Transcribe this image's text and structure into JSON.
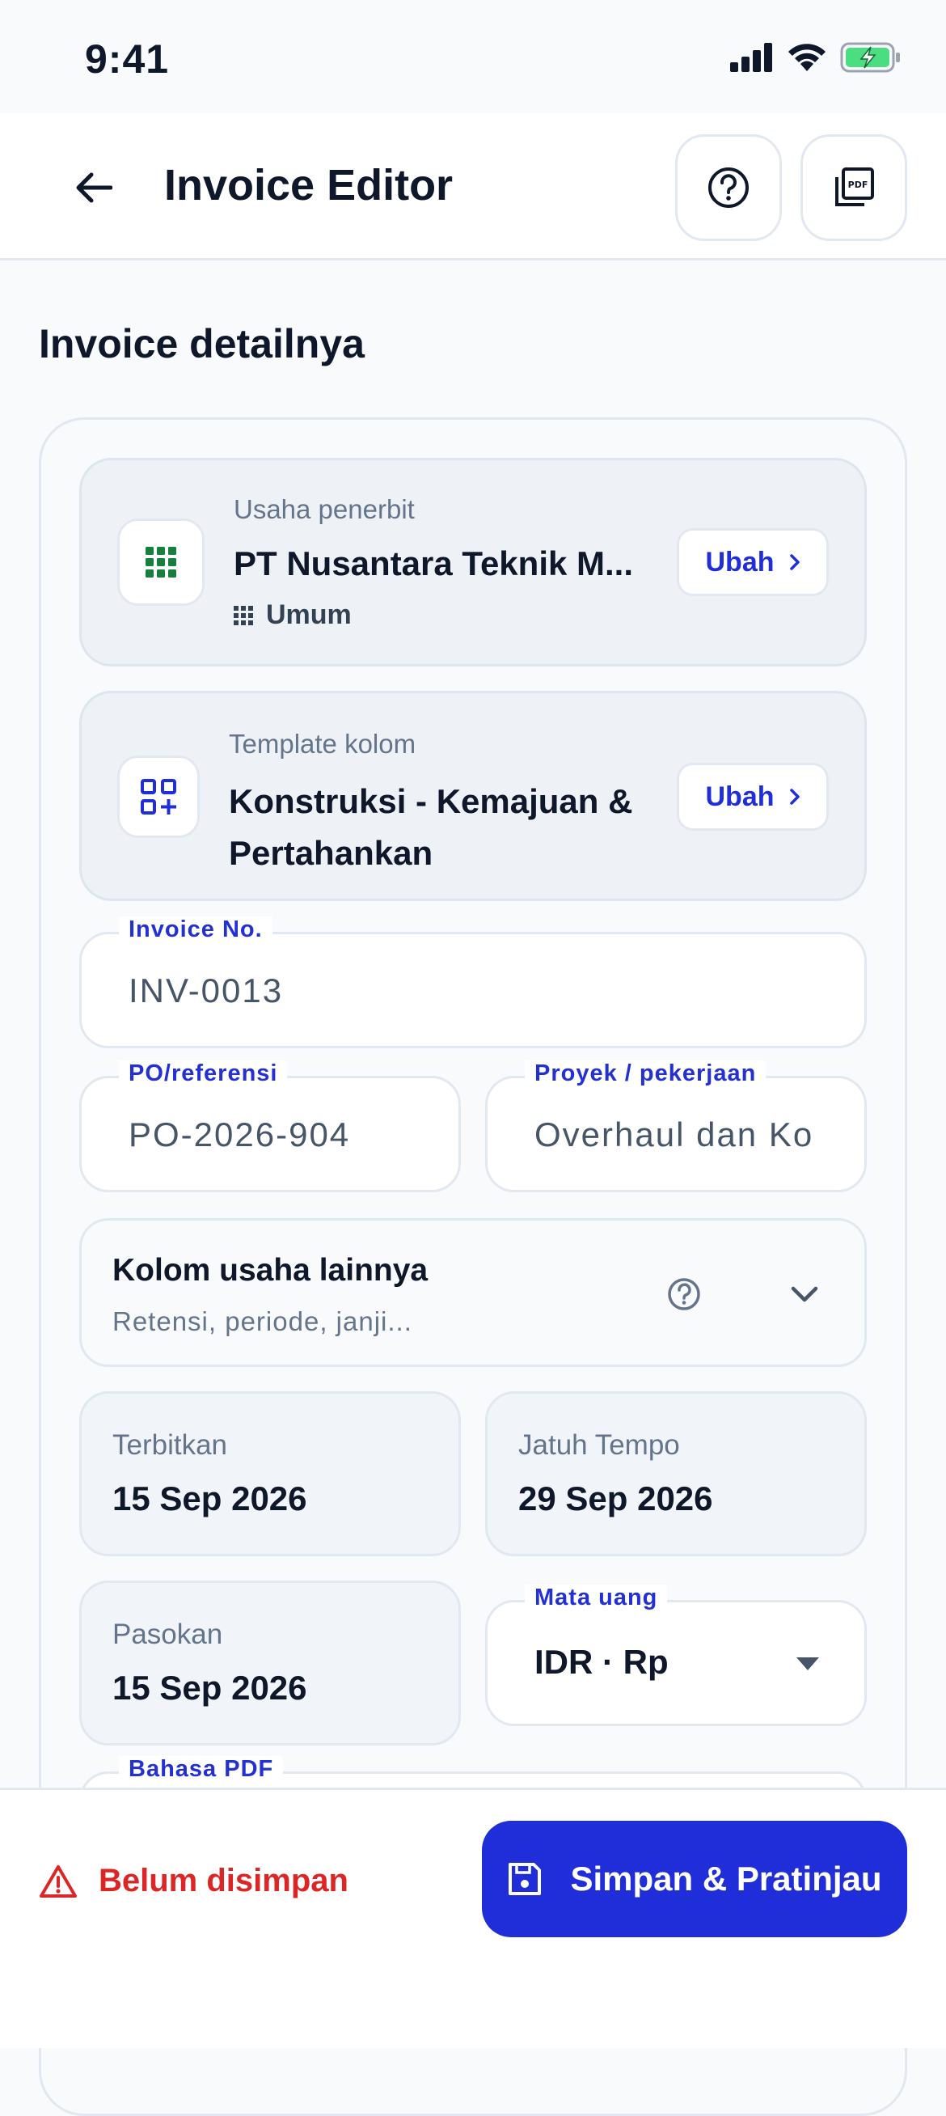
{
  "status_bar": {
    "time": "9:41"
  },
  "app_bar": {
    "title": "Invoice Editor"
  },
  "section": {
    "title": "Invoice detailnya"
  },
  "issuer_card": {
    "label": "Usaha penerbit",
    "value": "PT Nusantara Teknik M...",
    "tag": "Umum",
    "change_label": "Ubah"
  },
  "template_card": {
    "label": "Template kolom",
    "value_line1": "Konstruksi - Kemajuan &",
    "value_line2": "Pertahankan",
    "change_label": "Ubah"
  },
  "fields": {
    "invoice_no": {
      "label": "Invoice No.",
      "value": "INV-0013"
    },
    "po_ref": {
      "label": "PO/referensi",
      "value": "PO-2026-904"
    },
    "project": {
      "label": "Proyek / pekerjaan",
      "value": "Overhaul dan Ko"
    },
    "currency": {
      "label": "Mata uang",
      "value": "IDR · Rp"
    },
    "pdf_language": {
      "label": "Bahasa PDF"
    }
  },
  "more_fields": {
    "title": "Kolom usaha lainnya",
    "subtitle": "Retensi, periode, janji..."
  },
  "dates": {
    "issued": {
      "label": "Terbitkan",
      "value": "15 Sep 2026"
    },
    "due": {
      "label": "Jatuh Tempo",
      "value": "29 Sep 2026"
    },
    "supply": {
      "label": "Pasokan",
      "value": "15 Sep 2026"
    }
  },
  "bottom_bar": {
    "unsaved_label": "Belum disimpan",
    "save_label": "Simpan & Pratinjau"
  },
  "colors": {
    "accent": "#1f2ed8",
    "danger": "#dc2626",
    "brand_green": "#15803d",
    "battery_green": "#4ade80"
  }
}
